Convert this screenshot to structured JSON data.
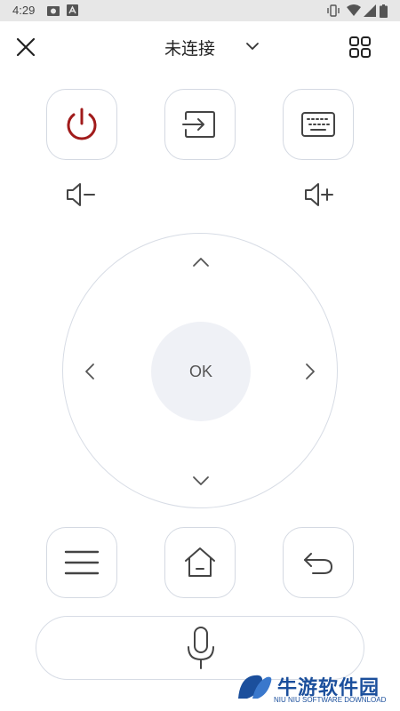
{
  "status_bar": {
    "time": "4:29"
  },
  "header": {
    "title": "未连接"
  },
  "dpad": {
    "ok_label": "OK"
  },
  "watermark": {
    "title": "牛游软件园",
    "subtitle": "NIU NIU SOFTWARE DOWNLOAD"
  },
  "colors": {
    "power_red": "#a11b1b",
    "border": "#d4d9e2",
    "ok_bg": "#eff1f6",
    "watermark_blue": "#1b4f9c"
  }
}
